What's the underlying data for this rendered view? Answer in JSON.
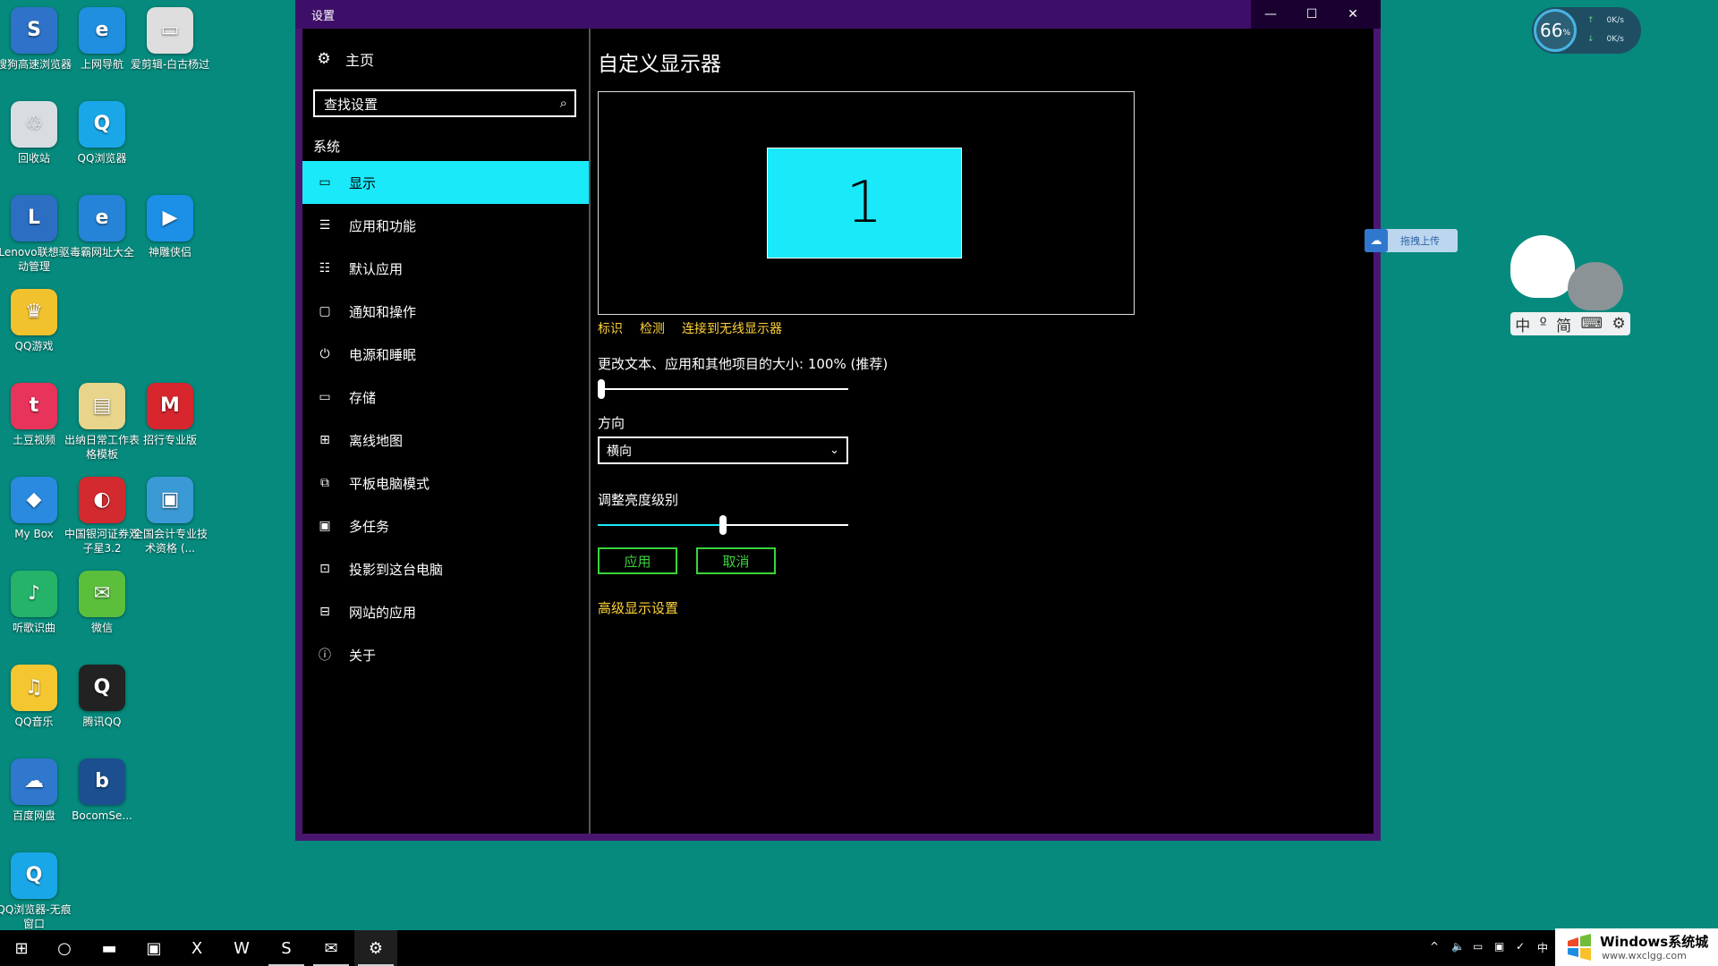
{
  "desktop": {
    "icons": [
      {
        "label": "搜狗高速浏览器",
        "glyph": "S",
        "color": "#2e73c9"
      },
      {
        "label": "上网导航",
        "glyph": "e",
        "color": "#1f8fe0"
      },
      {
        "label": "爱剪辑-白古杨过",
        "glyph": "▭",
        "color": "#dedede"
      },
      {
        "label": "回收站",
        "glyph": "♲",
        "color": "#d8dde2"
      },
      {
        "label": "QQ浏览器",
        "glyph": "Q",
        "color": "#1aa7e8"
      },
      {
        "label": "Lenovo联想驱动管理",
        "glyph": "L",
        "color": "#2c6fc2"
      },
      {
        "label": "毒霸网址大全",
        "glyph": "e",
        "color": "#2584d8"
      },
      {
        "label": "神雕侠侣",
        "glyph": "▶",
        "color": "#1c8fe6"
      },
      {
        "label": "QQ游戏",
        "glyph": "♛",
        "color": "#f2c12e"
      },
      {
        "label": "土豆视频",
        "glyph": "t",
        "color": "#e8335a"
      },
      {
        "label": "出纳日常工作表格模板",
        "glyph": "▤",
        "color": "#e8d48a"
      },
      {
        "label": "招行专业版",
        "glyph": "M",
        "color": "#d7262e"
      },
      {
        "label": "My Box",
        "glyph": "◆",
        "color": "#2a8ae0"
      },
      {
        "label": "中国银河证券双子星3.2",
        "glyph": "◐",
        "color": "#d32a2f"
      },
      {
        "label": "全国会计专业技术资格 (...",
        "glyph": "▣",
        "color": "#3a9ad6"
      },
      {
        "label": "听歌识曲",
        "glyph": "♪",
        "color": "#25b36a"
      },
      {
        "label": "微信",
        "glyph": "✉",
        "color": "#5bbf3b"
      },
      {
        "label": "QQ音乐",
        "glyph": "♫",
        "color": "#f4c730"
      },
      {
        "label": "腾讯QQ",
        "glyph": "Q",
        "color": "#222222"
      },
      {
        "label": "百度网盘",
        "glyph": "☁",
        "color": "#2f78ce"
      },
      {
        "label": "BocomSe...",
        "glyph": "b",
        "color": "#1b4f8f"
      },
      {
        "label": "QQ浏览器-无痕窗口",
        "glyph": "Q",
        "color": "#1aa7e8"
      }
    ]
  },
  "window": {
    "title": "设置",
    "controls": {
      "minimize": "—",
      "maximize": "☐",
      "close": "✕"
    }
  },
  "nav": {
    "home": "主页",
    "search_placeholder": "查找设置",
    "section": "系统",
    "items": [
      {
        "label": "显示",
        "icon": "monitor-icon",
        "glyph": "▭"
      },
      {
        "label": "应用和功能",
        "icon": "apps-list-icon",
        "glyph": "☰"
      },
      {
        "label": "默认应用",
        "icon": "default-apps-icon",
        "glyph": "☷"
      },
      {
        "label": "通知和操作",
        "icon": "notification-icon",
        "glyph": "▢"
      },
      {
        "label": "电源和睡眠",
        "icon": "power-icon",
        "glyph": "⏻"
      },
      {
        "label": "存储",
        "icon": "storage-icon",
        "glyph": "▭"
      },
      {
        "label": "离线地图",
        "icon": "map-icon",
        "glyph": "⊞"
      },
      {
        "label": "平板电脑模式",
        "icon": "tablet-icon",
        "glyph": "⧉"
      },
      {
        "label": "多任务",
        "icon": "multitask-icon",
        "glyph": "▣"
      },
      {
        "label": "投影到这台电脑",
        "icon": "project-icon",
        "glyph": "⊡"
      },
      {
        "label": "网站的应用",
        "icon": "web-apps-icon",
        "glyph": "⊟"
      },
      {
        "label": "关于",
        "icon": "info-icon",
        "glyph": "ⓘ"
      }
    ]
  },
  "content": {
    "title": "自定义显示器",
    "monitor_number": "1",
    "links": [
      "标识",
      "检测",
      "连接到无线显示器"
    ],
    "scale_label": "更改文本、应用和其他项目的大小: 100% (推荐)",
    "scale_value": 0,
    "orientation_label": "方向",
    "orientation_value": "横向",
    "brightness_label": "调整亮度级别",
    "brightness_value": 0.5,
    "apply": "应用",
    "cancel": "取消",
    "advanced": "高级显示设置"
  },
  "speed_widget": {
    "percent": "66",
    "percent_unit": "%",
    "up": "0K/s",
    "down": "0K/s"
  },
  "baidu_tag": "拖拽上传",
  "ime": {
    "items": [
      "中",
      "º",
      "简",
      "⌨",
      "⚙"
    ]
  },
  "taskbar": {
    "apps": [
      {
        "name": "start",
        "glyph": "⊞"
      },
      {
        "name": "search",
        "glyph": "○"
      },
      {
        "name": "file-explorer",
        "glyph": "▬"
      },
      {
        "name": "store",
        "glyph": "▣"
      },
      {
        "name": "excel",
        "glyph": "X"
      },
      {
        "name": "word",
        "glyph": "W"
      },
      {
        "name": "sogou",
        "glyph": "S"
      },
      {
        "name": "wechat",
        "glyph": "✉"
      },
      {
        "name": "settings",
        "glyph": "⚙"
      }
    ],
    "tray": [
      "^",
      "🔈",
      "▭",
      "▣",
      "✓",
      "中"
    ],
    "watermark_title": "Windows系统城",
    "watermark_url": "www.wxclgg.com"
  },
  "colors": {
    "accent": "#1ae9f9",
    "link": "#ffd33a",
    "button": "#3bd43b",
    "titlebar": "#3e0f69",
    "desktop": "#058a7d"
  }
}
